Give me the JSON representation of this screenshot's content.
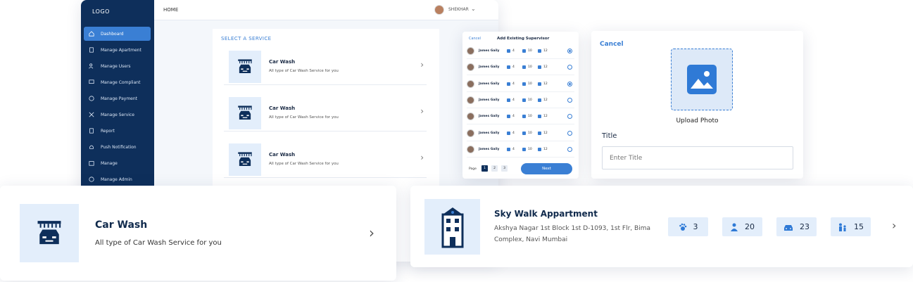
{
  "dashboard": {
    "logo": "LOGO",
    "breadcrumb": "HOME",
    "user_name": "SHEKHAR",
    "sidebar": [
      {
        "label": "Dashboard",
        "icon": "home-icon",
        "active": true
      },
      {
        "label": "Manage Apartment",
        "icon": "building-icon"
      },
      {
        "label": "Manage Users",
        "icon": "users-icon"
      },
      {
        "label": "Manage Compliant",
        "icon": "chat-icon"
      },
      {
        "label": "Manage Payment",
        "icon": "payment-icon"
      },
      {
        "label": "Manage Service",
        "icon": "tools-icon"
      },
      {
        "label": "Report",
        "icon": "report-icon"
      },
      {
        "label": "Push Notification",
        "icon": "bell-icon"
      },
      {
        "label": "Manage",
        "icon": "manage-icon"
      },
      {
        "label": "Manage Admin",
        "icon": "admin-icon"
      }
    ],
    "service_panel": {
      "title": "SELECT A SERVICE",
      "services": [
        {
          "name": "Car Wash",
          "description": "All type of Car Wash Service for you"
        },
        {
          "name": "Car Wash",
          "description": "All type of Car Wash Service for you"
        },
        {
          "name": "Car Wash",
          "description": "All type of Car Wash Service for you"
        }
      ]
    }
  },
  "supervisor_panel": {
    "cancel": "Cancel",
    "title": "Add Existing Supervisor",
    "rows": [
      {
        "name": "James Gaily",
        "s1": "4",
        "s2": "10",
        "s3": "12",
        "selected": true
      },
      {
        "name": "James Gaily",
        "s1": "4",
        "s2": "10",
        "s3": "12",
        "selected": false
      },
      {
        "name": "James Gaily",
        "s1": "4",
        "s2": "10",
        "s3": "12",
        "selected": true
      },
      {
        "name": "James Gaily",
        "s1": "4",
        "s2": "10",
        "s3": "12",
        "selected": false
      },
      {
        "name": "James Gaily",
        "s1": "4",
        "s2": "10",
        "s3": "12",
        "selected": false
      },
      {
        "name": "James Gaily",
        "s1": "4",
        "s2": "10",
        "s3": "12",
        "selected": false
      },
      {
        "name": "James Gaily",
        "s1": "4",
        "s2": "10",
        "s3": "12",
        "selected": false
      }
    ],
    "page_label": "Page",
    "pages": [
      "1",
      "2",
      "3"
    ],
    "next": "Next"
  },
  "upload_panel": {
    "cancel": "Cancel",
    "upload_label": "Upload Photo",
    "title_label": "Title",
    "title_placeholder": "Enter Title"
  },
  "car_wash_card": {
    "name": "Car Wash",
    "description": "All type of Car Wash Service for you"
  },
  "apartment_card": {
    "name": "Sky Walk Appartment",
    "address_line1": "Akshya Nagar 1st Block 1st D-1093, 1st Flr, Bima",
    "address_line2": "Complex, Navi Mumbai",
    "stats": [
      {
        "icon": "paw-icon",
        "value": "3"
      },
      {
        "icon": "person-icon",
        "value": "20"
      },
      {
        "icon": "car-icon",
        "value": "23"
      },
      {
        "icon": "family-icon",
        "value": "15"
      }
    ]
  },
  "colors": {
    "sidebar": "#0e2f5b",
    "accent": "#3a7fd4",
    "tile": "#e3eefb"
  }
}
